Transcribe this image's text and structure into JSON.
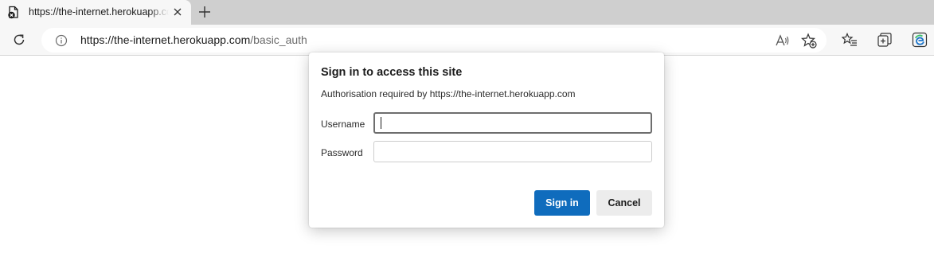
{
  "tab": {
    "title": "https://the-internet.herokuapp.com/basic_auth",
    "favicon": "page-error-icon",
    "close_icon": "close-icon",
    "new_tab_icon": "plus-icon"
  },
  "toolbar": {
    "reload_icon": "reload-icon",
    "site_info_icon": "info-icon",
    "url_host": "https://the-internet.herokuapp.com",
    "url_path": "/basic_auth",
    "read_aloud_icon": "read-aloud-icon",
    "add_favorite_icon": "add-favorite-icon",
    "favorites_icon": "favorites-icon",
    "collections_icon": "collections-icon",
    "edge_icon": "edge-logo-icon"
  },
  "dialog": {
    "title": "Sign in to access this site",
    "subtitle": "Authorisation required by https://the-internet.herokuapp.com",
    "username_label": "Username",
    "username_value": "",
    "password_label": "Password",
    "password_value": "",
    "sign_in_label": "Sign in",
    "cancel_label": "Cancel",
    "accent_color": "#0f6cbd"
  }
}
